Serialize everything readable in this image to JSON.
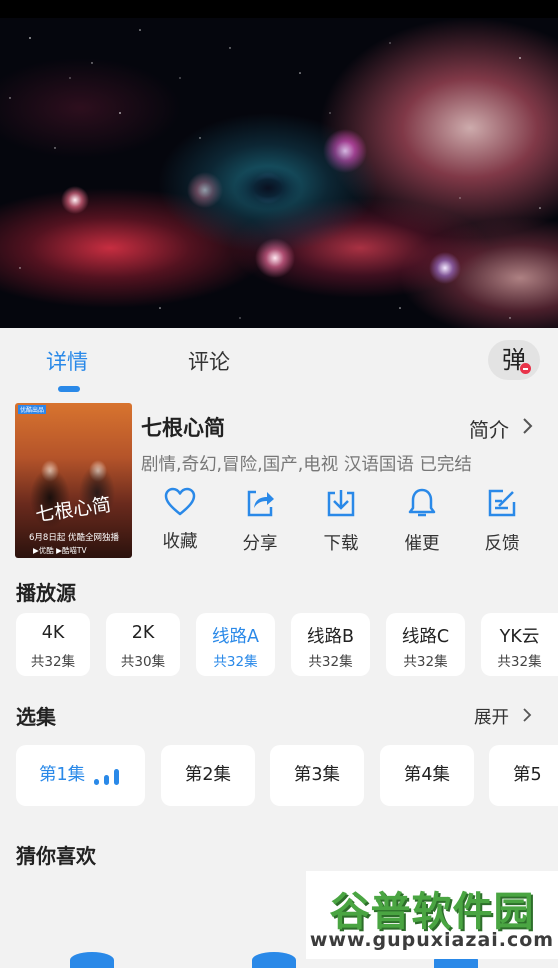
{
  "tabs": {
    "detail": "详情",
    "comment": "评论"
  },
  "danmu_toggle": "弹",
  "show": {
    "title": "七根心简",
    "intro": "简介",
    "meta": "剧情,奇幻,冒险,国产,电视 汉语国语 已完结",
    "poster": {
      "title": "七根心简",
      "date": "6月8日起 优酷全网独播",
      "logos": "▶优酷 ▶酷喵TV",
      "badge": "优酷出品"
    }
  },
  "actions": [
    {
      "label": "收藏",
      "icon": "heart-icon"
    },
    {
      "label": "分享",
      "icon": "share-icon"
    },
    {
      "label": "下载",
      "icon": "download-icon"
    },
    {
      "label": "催更",
      "icon": "bell-icon"
    },
    {
      "label": "反馈",
      "icon": "edit-icon"
    }
  ],
  "sources_title": "播放源",
  "sources": [
    {
      "name": "4K",
      "count": "共32集"
    },
    {
      "name": "2K",
      "count": "共30集"
    },
    {
      "name": "线路A",
      "count": "共32集"
    },
    {
      "name": "线路B",
      "count": "共32集"
    },
    {
      "name": "线路C",
      "count": "共32集"
    },
    {
      "name": "YK云",
      "count": "共32集"
    }
  ],
  "episodes_title": "选集",
  "expand": "展开",
  "episodes": [
    "第1集",
    "第2集",
    "第3集",
    "第4集",
    "第5"
  ],
  "guess_title": "猜你喜欢",
  "watermark": {
    "title": "谷普软件园",
    "url": "www.gupuxiazai.com"
  },
  "colors": {
    "accent": "#2a89e8",
    "background": "#f2f2f2"
  }
}
